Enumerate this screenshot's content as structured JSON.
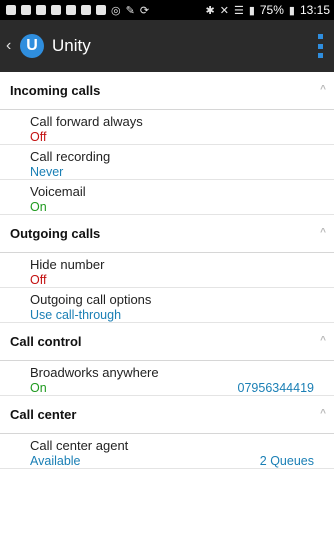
{
  "statusbar": {
    "battery": "75%",
    "time": "13:15",
    "icons": [
      "notification-icon",
      "notification-icon",
      "notification-icon",
      "notification-icon",
      "notification-icon",
      "notification-icon",
      "notification-icon",
      "vpn-icon",
      "tools-icon",
      "sync-icon",
      "bluetooth-icon",
      "mute-icon",
      "wifi-icon",
      "signal-icon",
      "battery-icon"
    ]
  },
  "appbar": {
    "logo_letter": "U",
    "title": "Unity"
  },
  "sections": {
    "incoming": {
      "title": "Incoming calls",
      "items": [
        {
          "label": "Call forward always",
          "value": "Off"
        },
        {
          "label": "Call recording",
          "value": "Never"
        },
        {
          "label": "Voicemail",
          "value": "On"
        }
      ]
    },
    "outgoing": {
      "title": "Outgoing calls",
      "items": [
        {
          "label": "Hide number",
          "value": "Off"
        },
        {
          "label": "Outgoing call options",
          "value": "Use call-through"
        }
      ]
    },
    "control": {
      "title": "Call control",
      "items": [
        {
          "label": "Broadworks anywhere",
          "value": "On",
          "right": "07956344419"
        }
      ]
    },
    "center": {
      "title": "Call center",
      "items": [
        {
          "label": "Call center agent",
          "value": "Available",
          "right": "2 Queues"
        }
      ]
    }
  },
  "colors": {
    "accent": "#2f8ede",
    "off": "#c31010",
    "on": "#1f9a1f",
    "info": "#1a7fb5"
  }
}
